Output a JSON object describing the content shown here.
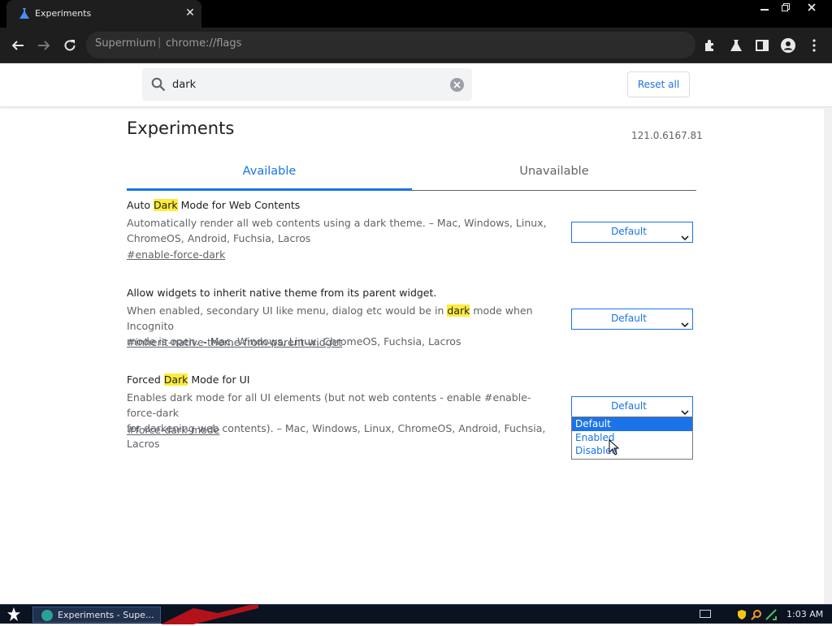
{
  "browser": {
    "tab_title": "Experiments",
    "site_name": "Supermium",
    "separator": "|",
    "url": "chrome://flags"
  },
  "header": {
    "search_value": "dark",
    "reset_label": "Reset all"
  },
  "page": {
    "title": "Experiments",
    "version": "121.0.6167.81",
    "tabs": [
      {
        "label": "Available"
      },
      {
        "label": "Unavailable"
      }
    ]
  },
  "experiments": [
    {
      "title_before": "Auto ",
      "title_highlight": "Dark",
      "title_after": " Mode for Web Contents",
      "desc_line1": "Automatically render all web contents using a dark theme. – Mac, Windows, Linux,",
      "desc_line2": "ChromeOS, Android, Fuchsia, Lacros",
      "link": "#enable-force-dark",
      "select_value": "Default"
    },
    {
      "title": "Allow widgets to inherit native theme from its parent widget.",
      "desc_before": "When enabled, secondary UI like menu, dialog etc would be in ",
      "desc_highlight": "dark",
      "desc_after": " mode when Incognito",
      "desc_line2": "mode is open. – Mac, Windows, Linux, ChromeOS, Fuchsia, Lacros",
      "link": "#inherit-native-theme-from-parent-widget",
      "select_value": "Default"
    },
    {
      "title_before": "Forced ",
      "title_highlight": "Dark",
      "title_after": " Mode for UI",
      "desc_line1": "Enables dark mode for all UI elements (but not web contents - enable #enable-force-dark",
      "desc_line2": "for darkening web contents). – Mac, Windows, Linux, ChromeOS, Android, Fuchsia, Lacros",
      "link": "#force-dark-mode",
      "select_value": "Default",
      "dropdown_options": [
        "Default",
        "Enabled",
        "Disabled"
      ]
    }
  ],
  "taskbar": {
    "task_label": "Experiments - Supe...",
    "clock": "1:03 AM"
  },
  "colors": {
    "accent": "#1a73e8",
    "highlight": "#ffeb3b",
    "chrome_dark": "#1e1e1e"
  }
}
